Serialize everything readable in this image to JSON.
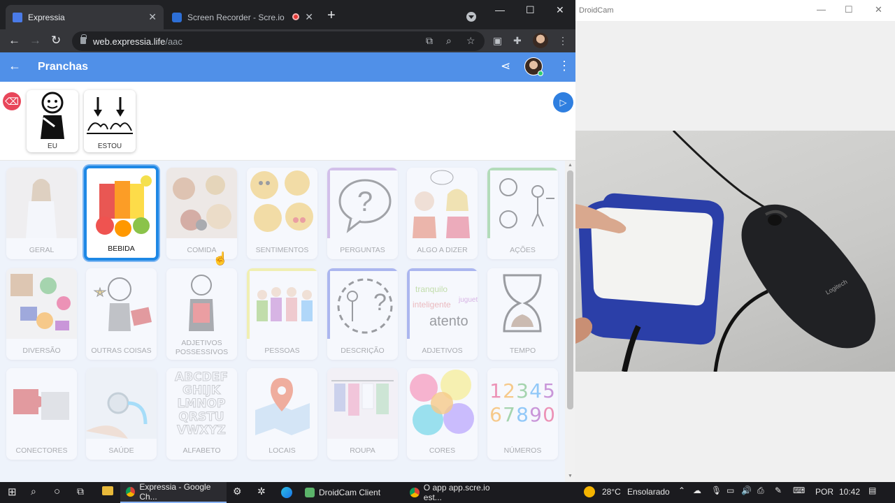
{
  "browser": {
    "tabs": [
      {
        "title": "Expressia",
        "active": true
      },
      {
        "title": "Screen Recorder - Scre.io",
        "active": false
      }
    ],
    "url_host": "web.expressia.life",
    "url_path": "/aac"
  },
  "app": {
    "title": "Pranchas",
    "sentence": [
      {
        "label": "EU"
      },
      {
        "label": "ESTOU"
      }
    ],
    "grid": [
      {
        "label": "GERAL"
      },
      {
        "label": "BEBIDA",
        "selected": true
      },
      {
        "label": "COMIDA"
      },
      {
        "label": "SENTIMENTOS"
      },
      {
        "label": "PERGUNTAS",
        "frame": "#b083d6"
      },
      {
        "label": "ALGO A DIZER"
      },
      {
        "label": "AÇÕES",
        "frame": "#6cc06c"
      },
      {
        "label": "DIVERSÃO"
      },
      {
        "label": "OUTRAS COISAS"
      },
      {
        "label": "ADJETIVOS POSSESSIVOS"
      },
      {
        "label": "PESSOAS",
        "frame": "#f2ea5a"
      },
      {
        "label": "DESCRIÇÃO",
        "frame": "#5a6ee0"
      },
      {
        "label": "ADJETIVOS",
        "frame": "#5a6ee0"
      },
      {
        "label": "TEMPO"
      },
      {
        "label": "CONECTORES"
      },
      {
        "label": "SAÚDE"
      },
      {
        "label": "ALFABETO"
      },
      {
        "label": "LOCAIS"
      },
      {
        "label": "ROUPA"
      },
      {
        "label": "CORES"
      },
      {
        "label": "NÚMEROS"
      }
    ],
    "alphabet_text": "ABCDEF GHIJK LMNOP QRSTU VWXYZ",
    "numbers_text": "12345 67890",
    "adjetivos_words": [
      "tranquilo",
      "inteligente",
      "atento",
      "juguete"
    ]
  },
  "droidcam": {
    "title": "DroidCam",
    "mouse_brand": "Logitech"
  },
  "taskbar": {
    "apps": [
      {
        "title": "Expressia - Google Ch...",
        "open": true
      },
      {
        "title": "DroidCam Client",
        "open": false
      },
      {
        "title": "O app app.scre.io est...",
        "open": false
      }
    ],
    "weather_temp": "28°C",
    "weather_desc": "Ensolarado",
    "lang": "POR",
    "time": "10:42"
  }
}
